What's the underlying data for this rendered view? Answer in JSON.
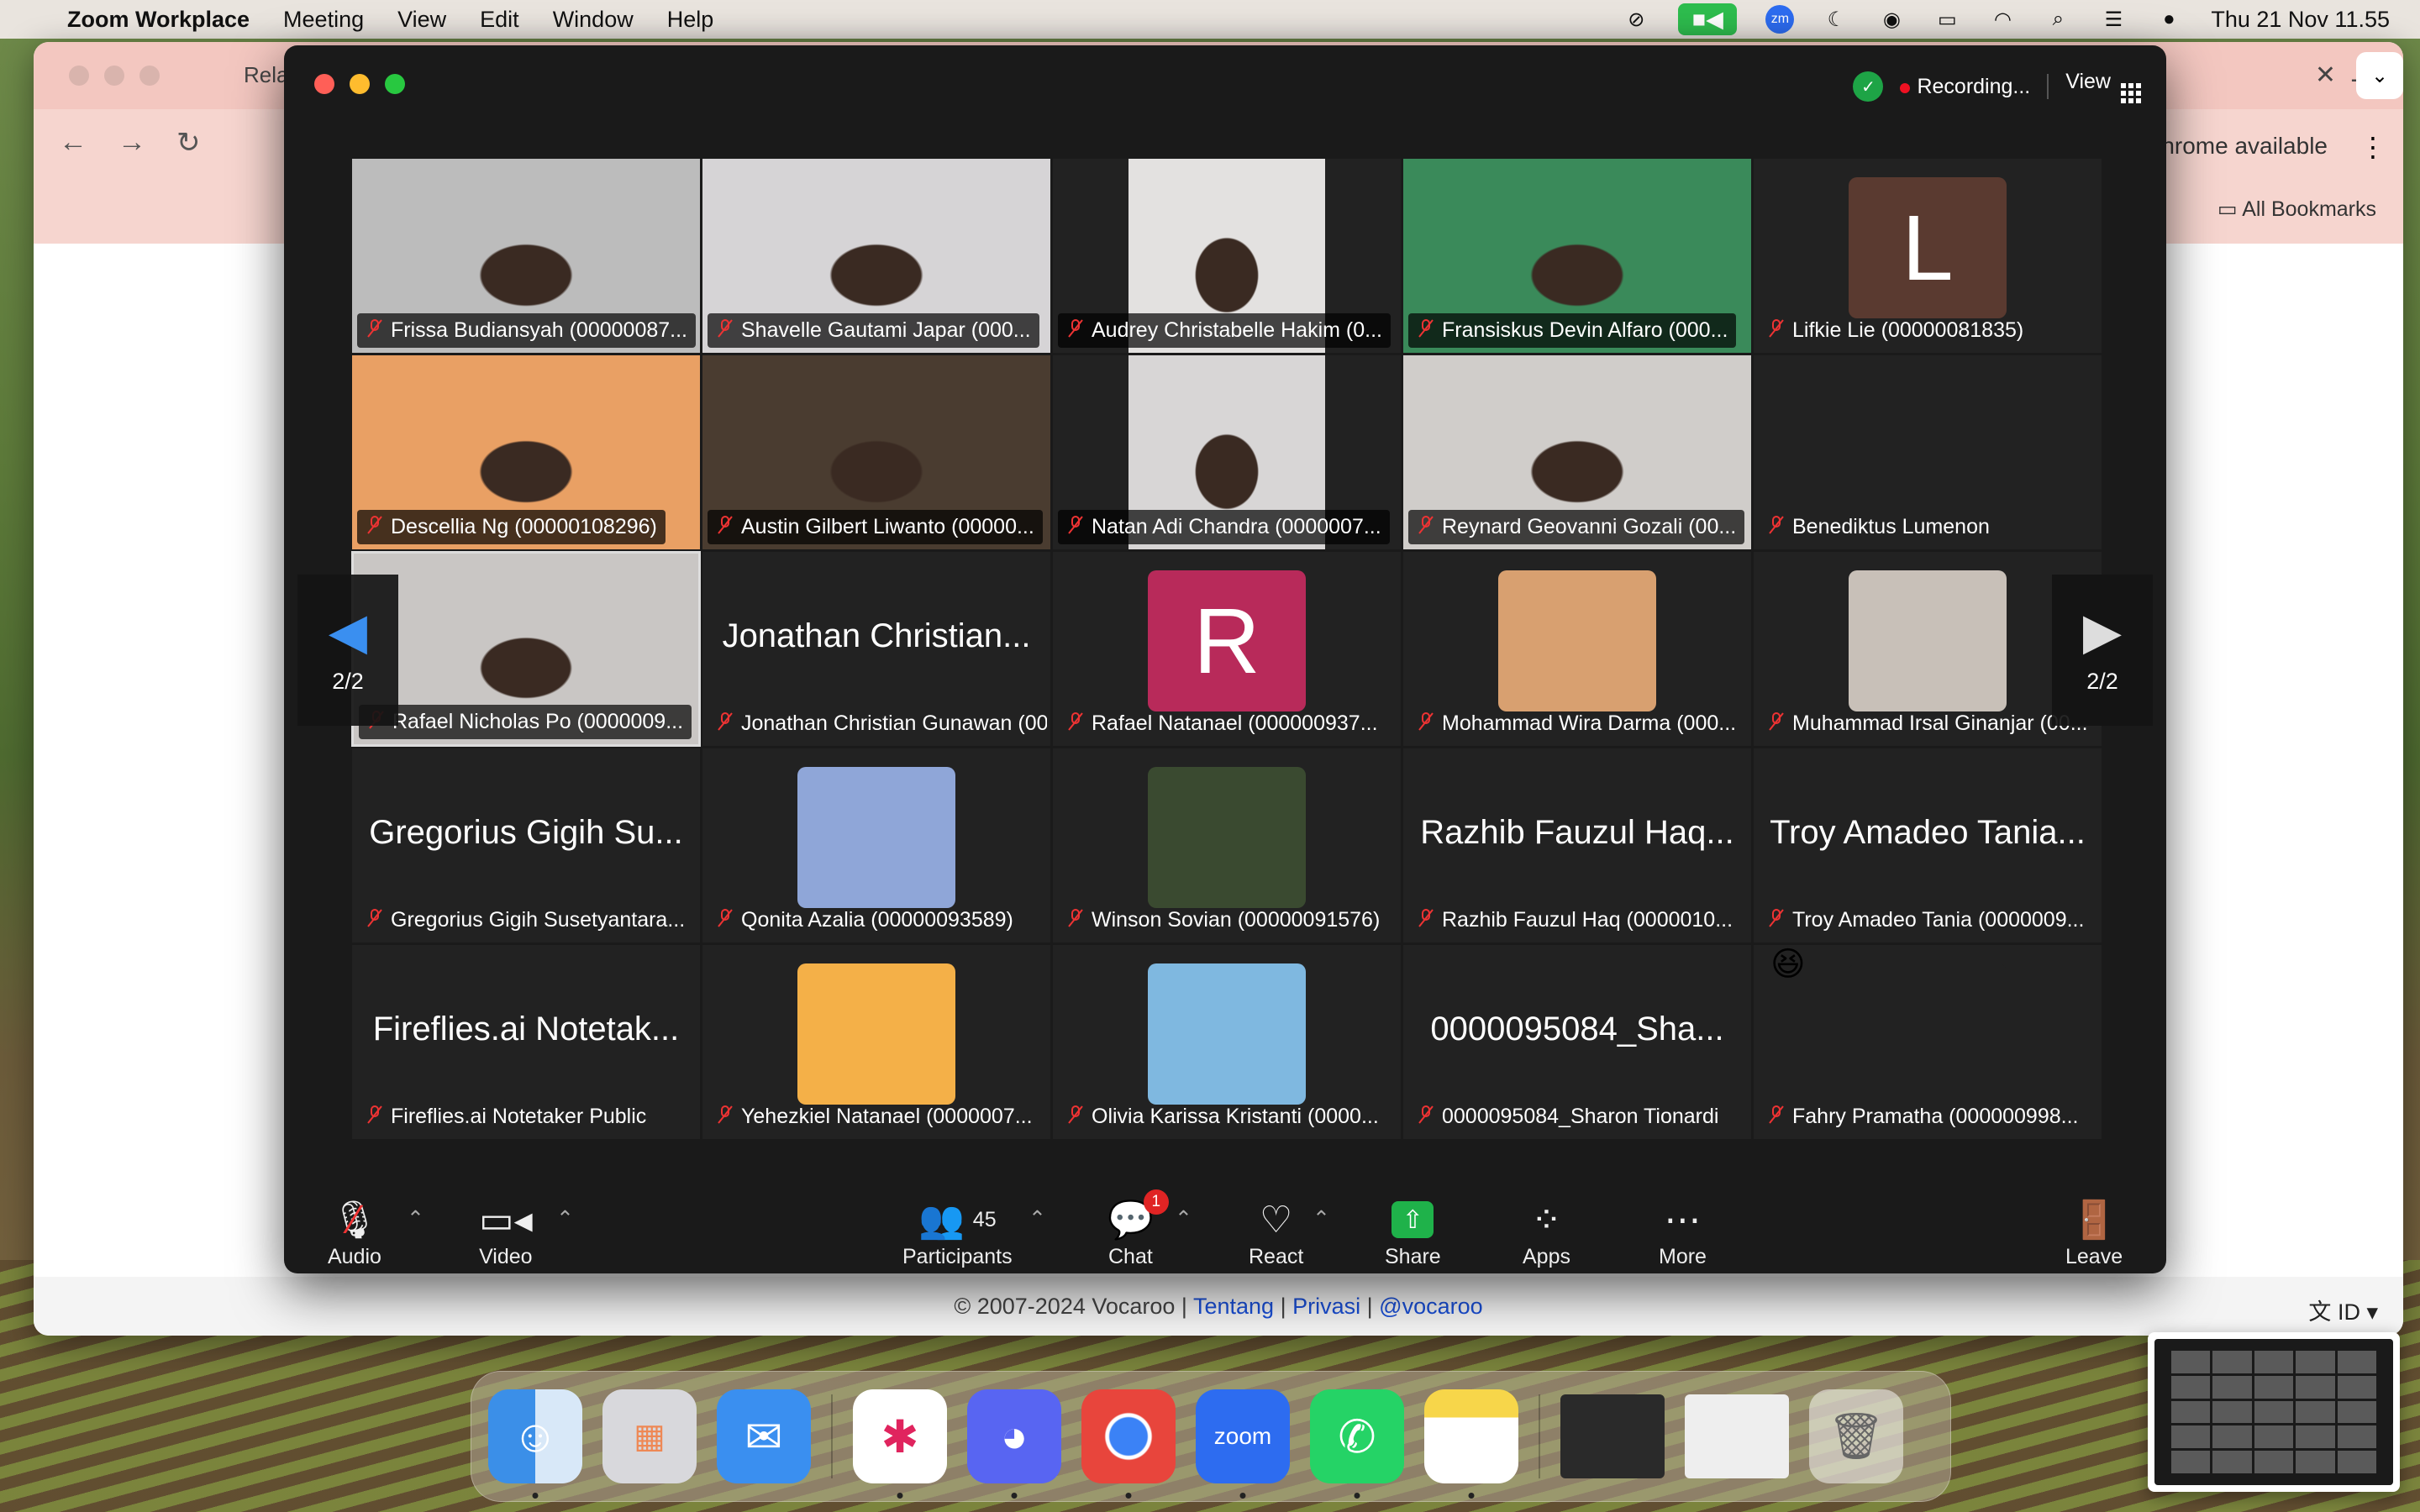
{
  "menubar": {
    "app_name": "Zoom Workplace",
    "menus": [
      "Meeting",
      "View",
      "Edit",
      "Window",
      "Help"
    ],
    "datetime": "Thu 21 Nov  11.55"
  },
  "chrome": {
    "tab_title": "Rela",
    "update_text": "w Chrome available",
    "bookmarks_label": "All Bookmarks",
    "footer": {
      "copyright": "© 2007-2024 Vocaroo |",
      "link1": "Tentang",
      "pipe1": "|",
      "link2": "Privasi",
      "pipe2": "|",
      "link3": "@vocaroo"
    },
    "language": "ID"
  },
  "zoom": {
    "recording_label": "Recording...",
    "view_label": "View",
    "page_indicator_left": "2/2",
    "page_indicator_right": "2/2",
    "participants": [
      {
        "name": "Frissa Budiansyah (00000087...",
        "kind": "video",
        "bg": "#bcbcbc"
      },
      {
        "name": "Shavelle Gautami Japar (000...",
        "kind": "video",
        "bg": "#d6d4d6"
      },
      {
        "name": "Audrey Christabelle Hakim (0...",
        "kind": "video-narrow",
        "bg": "#e3e1e0"
      },
      {
        "name": "Fransiskus Devin Alfaro (000...",
        "kind": "video",
        "bg": "#3a8a5a"
      },
      {
        "name": "Lifkie Lie (00000081835)",
        "kind": "letter",
        "letter": "L",
        "bg": "#5a3a30"
      },
      {
        "name": "Descellia Ng (00000108296)",
        "kind": "video",
        "bg": "#e9a064"
      },
      {
        "name": "Austin Gilbert Liwanto (00000...",
        "kind": "video",
        "bg": "#4a3c30"
      },
      {
        "name": "Natan Adi Chandra (0000007...",
        "kind": "video-narrow",
        "bg": "#d8d6d6"
      },
      {
        "name": "Reynard Geovanni Gozali (00...",
        "kind": "video",
        "bg": "#d0cdca"
      },
      {
        "name": "Benediktus Lumenon",
        "kind": "empty"
      },
      {
        "name": "Rafael Nicholas Po (0000009...",
        "kind": "video",
        "bg": "#c9c6c4",
        "active": true
      },
      {
        "name": "Jonathan Christian Gunawan (00...",
        "kind": "text",
        "big": "Jonathan Christian..."
      },
      {
        "name": "Rafael Natanael (000000937...",
        "kind": "letter",
        "letter": "R",
        "bg": "#b82a5a"
      },
      {
        "name": "Mohammad Wira Darma (000...",
        "kind": "avatar",
        "bg": "#d8a070"
      },
      {
        "name": "Muhammad Irsal Ginanjar (00...",
        "kind": "avatar",
        "bg": "#c8c0b8"
      },
      {
        "name": "Gregorius Gigih Susetyantara...",
        "kind": "text",
        "big": "Gregorius Gigih Su..."
      },
      {
        "name": "Qonita Azalia (00000093589)",
        "kind": "avatar",
        "bg": "#8fa6d8"
      },
      {
        "name": "Winson Sovian (00000091576)",
        "kind": "avatar",
        "bg": "#3a4a30"
      },
      {
        "name": "Razhib Fauzul Haq (0000010...",
        "kind": "text",
        "big": "Razhib Fauzul Haq..."
      },
      {
        "name": "Troy Amadeo Tania (0000009...",
        "kind": "text",
        "big": "Troy Amadeo Tania..."
      },
      {
        "name": "Fireflies.ai Notetaker Public",
        "kind": "text",
        "big": "Fireflies.ai Notetak..."
      },
      {
        "name": "Yehezkiel Natanael (0000007...",
        "kind": "avatar",
        "bg": "#f4b048"
      },
      {
        "name": "Olivia Karissa Kristanti (0000...",
        "kind": "avatar",
        "bg": "#7fb8e0"
      },
      {
        "name": "0000095084_Sharon Tionardi",
        "kind": "text",
        "big": "0000095084_Sha..."
      },
      {
        "name": "Fahry Pramatha (000000998...",
        "kind": "avatar",
        "bg": "#222222",
        "emoji": "😆"
      }
    ],
    "controls": {
      "audio": "Audio",
      "video": "Video",
      "participants": "Participants",
      "participants_count": "45",
      "chat": "Chat",
      "chat_badge": "1",
      "react": "React",
      "share": "Share",
      "apps": "Apps",
      "more": "More",
      "leave": "Leave"
    }
  },
  "dock": {
    "zoom_label": "zoom"
  }
}
